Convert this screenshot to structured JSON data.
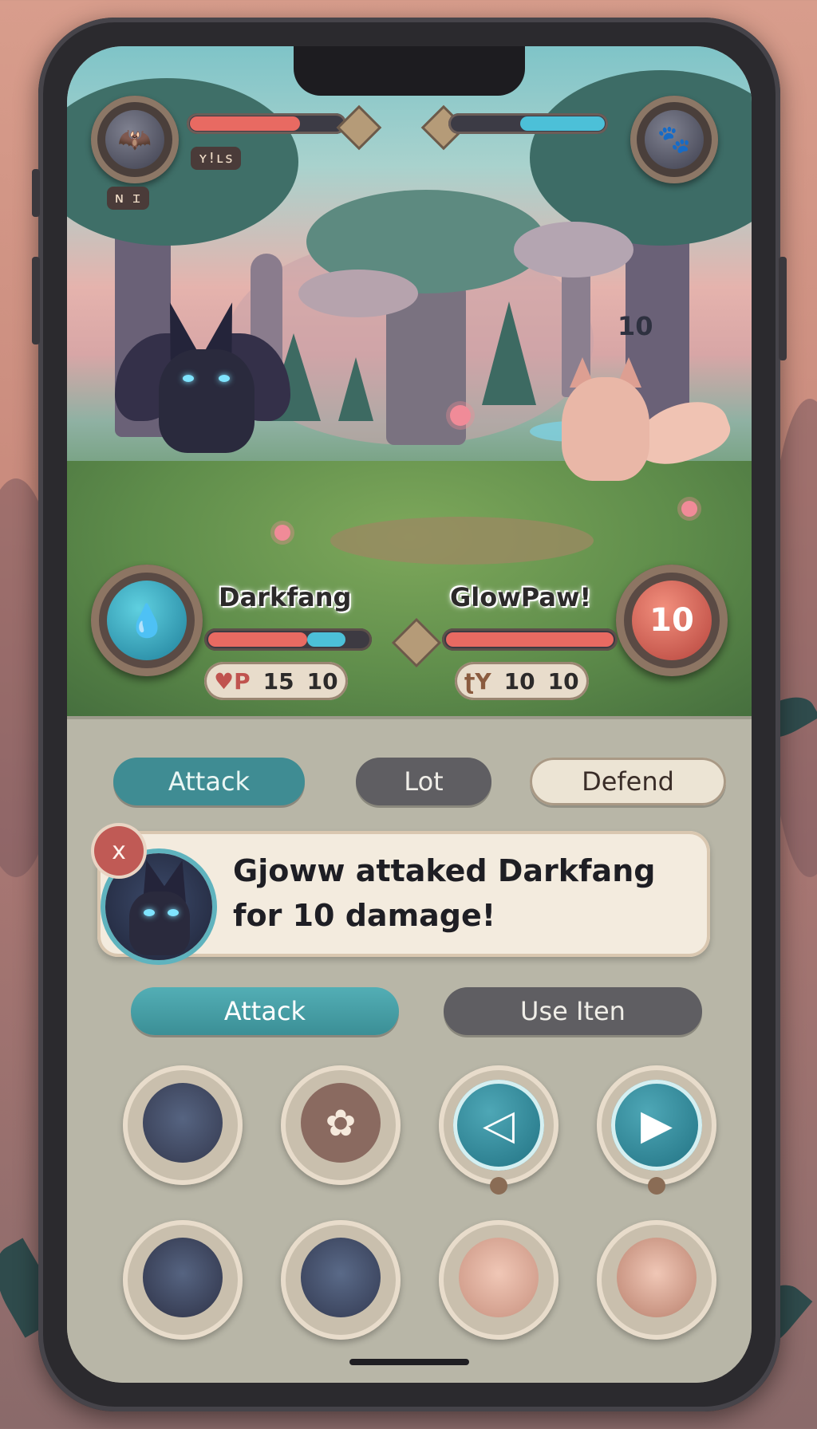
{
  "hud": {
    "player_badge_tag": "ʏ!ʟs",
    "player_level_tag": "ɴ ɪ",
    "player_hp_fraction": 0.72,
    "enemy_hp_fraction": 0.55,
    "damage_popup": "10"
  },
  "fighters": {
    "player": {
      "name": "Darkfang",
      "hp_fraction": 0.62,
      "shield_fraction": 0.24,
      "stat_label": "♥P",
      "stat_a": "15",
      "stat_b": "10"
    },
    "enemy": {
      "name": "GlowPaw!",
      "hp_fraction": 1.0,
      "badge_value": "10",
      "stat_label": "ʈY",
      "stat_a": "10",
      "stat_b": "10"
    }
  },
  "tabs": {
    "attack": "Attack",
    "middle": "Lot",
    "defend": "Defend"
  },
  "log": {
    "close_glyph": "x",
    "line1": "Gjoww attaked Darkfang",
    "line2": "for 10 damage!"
  },
  "actions": {
    "attack": "Attack",
    "use_item": "Use Iten"
  },
  "slots": {
    "slot2_glyph": "✿",
    "slot3_glyph": "◁",
    "slot4_glyph": "▶"
  },
  "colors": {
    "accent_teal": "#3f8c93",
    "hp_red": "#e86a62",
    "shield_blue": "#4cc0d8",
    "panel_bg": "#b8b6a7"
  }
}
